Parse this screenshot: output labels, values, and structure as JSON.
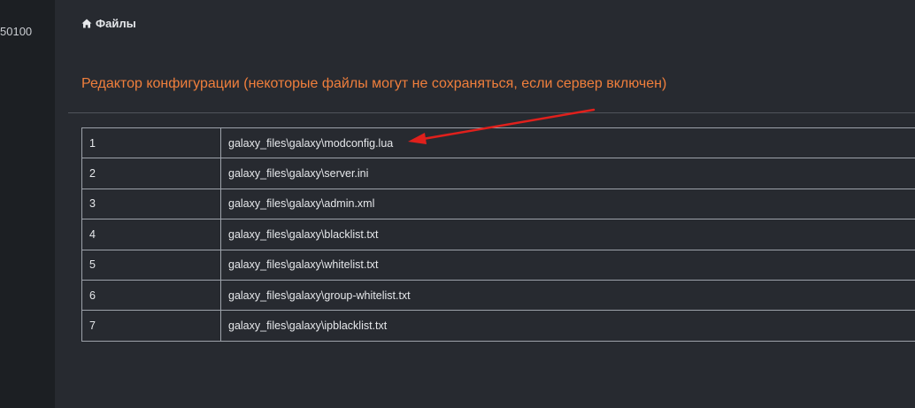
{
  "sidebar": {
    "partial_text": "50100"
  },
  "breadcrumb": {
    "icon": "home-icon",
    "label": "Файлы"
  },
  "section": {
    "title": "Редактор конфигурации (некоторые файлы могут не сохраняться, если сервер включен)"
  },
  "files": [
    {
      "index": "1",
      "path": "galaxy_files\\galaxy\\modconfig.lua"
    },
    {
      "index": "2",
      "path": "galaxy_files\\galaxy\\server.ini"
    },
    {
      "index": "3",
      "path": "galaxy_files\\galaxy\\admin.xml"
    },
    {
      "index": "4",
      "path": "galaxy_files\\galaxy\\blacklist.txt"
    },
    {
      "index": "5",
      "path": "galaxy_files\\galaxy\\whitelist.txt"
    },
    {
      "index": "6",
      "path": "galaxy_files\\galaxy\\group-whitelist.txt"
    },
    {
      "index": "7",
      "path": "galaxy_files\\galaxy\\ipblacklist.txt"
    }
  ],
  "colors": {
    "accent_title": "#f07f3c",
    "annotation_arrow": "#e0201c"
  }
}
